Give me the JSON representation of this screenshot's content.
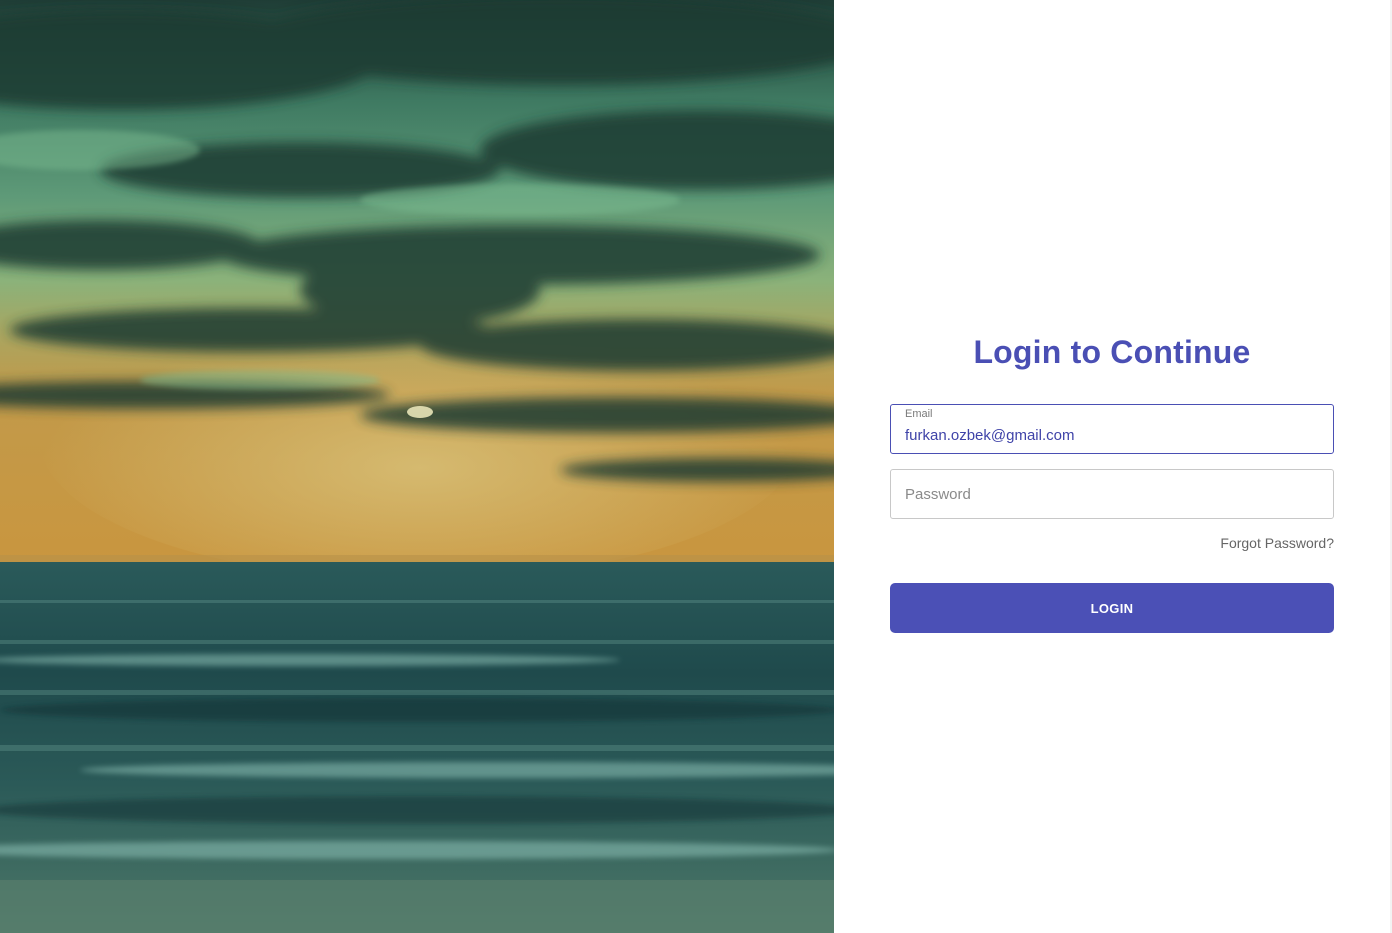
{
  "hero": {
    "image_icon": "seascape-sunset-image"
  },
  "form": {
    "title": "Login to Continue",
    "email": {
      "label": "Email",
      "value": "furkan.ozbek@gmail.com"
    },
    "password": {
      "placeholder": "Password",
      "value": ""
    },
    "forgot_label": "Forgot Password?",
    "login_label": "LOGIN"
  },
  "colors": {
    "accent": "#4b50b6",
    "title": "#4a4fb4"
  }
}
